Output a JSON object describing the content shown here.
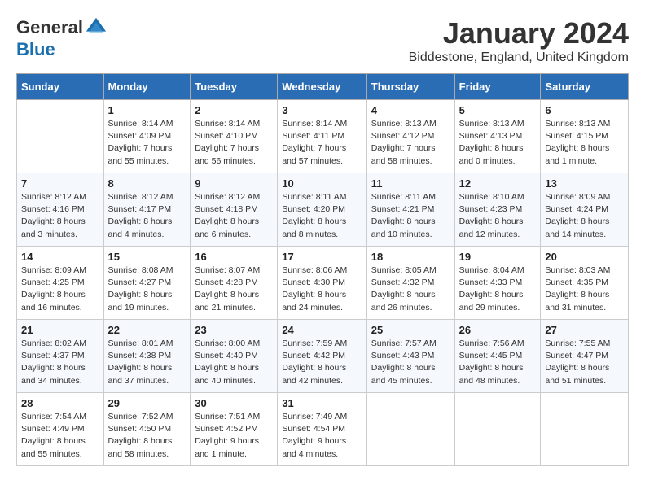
{
  "logo": {
    "general": "General",
    "blue": "Blue"
  },
  "title": "January 2024",
  "location": "Biddestone, England, United Kingdom",
  "days_header": [
    "Sunday",
    "Monday",
    "Tuesday",
    "Wednesday",
    "Thursday",
    "Friday",
    "Saturday"
  ],
  "weeks": [
    [
      {
        "num": "",
        "sunrise": "",
        "sunset": "",
        "daylight": ""
      },
      {
        "num": "1",
        "sunrise": "Sunrise: 8:14 AM",
        "sunset": "Sunset: 4:09 PM",
        "daylight": "Daylight: 7 hours and 55 minutes."
      },
      {
        "num": "2",
        "sunrise": "Sunrise: 8:14 AM",
        "sunset": "Sunset: 4:10 PM",
        "daylight": "Daylight: 7 hours and 56 minutes."
      },
      {
        "num": "3",
        "sunrise": "Sunrise: 8:14 AM",
        "sunset": "Sunset: 4:11 PM",
        "daylight": "Daylight: 7 hours and 57 minutes."
      },
      {
        "num": "4",
        "sunrise": "Sunrise: 8:13 AM",
        "sunset": "Sunset: 4:12 PM",
        "daylight": "Daylight: 7 hours and 58 minutes."
      },
      {
        "num": "5",
        "sunrise": "Sunrise: 8:13 AM",
        "sunset": "Sunset: 4:13 PM",
        "daylight": "Daylight: 8 hours and 0 minutes."
      },
      {
        "num": "6",
        "sunrise": "Sunrise: 8:13 AM",
        "sunset": "Sunset: 4:15 PM",
        "daylight": "Daylight: 8 hours and 1 minute."
      }
    ],
    [
      {
        "num": "7",
        "sunrise": "Sunrise: 8:12 AM",
        "sunset": "Sunset: 4:16 PM",
        "daylight": "Daylight: 8 hours and 3 minutes."
      },
      {
        "num": "8",
        "sunrise": "Sunrise: 8:12 AM",
        "sunset": "Sunset: 4:17 PM",
        "daylight": "Daylight: 8 hours and 4 minutes."
      },
      {
        "num": "9",
        "sunrise": "Sunrise: 8:12 AM",
        "sunset": "Sunset: 4:18 PM",
        "daylight": "Daylight: 8 hours and 6 minutes."
      },
      {
        "num": "10",
        "sunrise": "Sunrise: 8:11 AM",
        "sunset": "Sunset: 4:20 PM",
        "daylight": "Daylight: 8 hours and 8 minutes."
      },
      {
        "num": "11",
        "sunrise": "Sunrise: 8:11 AM",
        "sunset": "Sunset: 4:21 PM",
        "daylight": "Daylight: 8 hours and 10 minutes."
      },
      {
        "num": "12",
        "sunrise": "Sunrise: 8:10 AM",
        "sunset": "Sunset: 4:23 PM",
        "daylight": "Daylight: 8 hours and 12 minutes."
      },
      {
        "num": "13",
        "sunrise": "Sunrise: 8:09 AM",
        "sunset": "Sunset: 4:24 PM",
        "daylight": "Daylight: 8 hours and 14 minutes."
      }
    ],
    [
      {
        "num": "14",
        "sunrise": "Sunrise: 8:09 AM",
        "sunset": "Sunset: 4:25 PM",
        "daylight": "Daylight: 8 hours and 16 minutes."
      },
      {
        "num": "15",
        "sunrise": "Sunrise: 8:08 AM",
        "sunset": "Sunset: 4:27 PM",
        "daylight": "Daylight: 8 hours and 19 minutes."
      },
      {
        "num": "16",
        "sunrise": "Sunrise: 8:07 AM",
        "sunset": "Sunset: 4:28 PM",
        "daylight": "Daylight: 8 hours and 21 minutes."
      },
      {
        "num": "17",
        "sunrise": "Sunrise: 8:06 AM",
        "sunset": "Sunset: 4:30 PM",
        "daylight": "Daylight: 8 hours and 24 minutes."
      },
      {
        "num": "18",
        "sunrise": "Sunrise: 8:05 AM",
        "sunset": "Sunset: 4:32 PM",
        "daylight": "Daylight: 8 hours and 26 minutes."
      },
      {
        "num": "19",
        "sunrise": "Sunrise: 8:04 AM",
        "sunset": "Sunset: 4:33 PM",
        "daylight": "Daylight: 8 hours and 29 minutes."
      },
      {
        "num": "20",
        "sunrise": "Sunrise: 8:03 AM",
        "sunset": "Sunset: 4:35 PM",
        "daylight": "Daylight: 8 hours and 31 minutes."
      }
    ],
    [
      {
        "num": "21",
        "sunrise": "Sunrise: 8:02 AM",
        "sunset": "Sunset: 4:37 PM",
        "daylight": "Daylight: 8 hours and 34 minutes."
      },
      {
        "num": "22",
        "sunrise": "Sunrise: 8:01 AM",
        "sunset": "Sunset: 4:38 PM",
        "daylight": "Daylight: 8 hours and 37 minutes."
      },
      {
        "num": "23",
        "sunrise": "Sunrise: 8:00 AM",
        "sunset": "Sunset: 4:40 PM",
        "daylight": "Daylight: 8 hours and 40 minutes."
      },
      {
        "num": "24",
        "sunrise": "Sunrise: 7:59 AM",
        "sunset": "Sunset: 4:42 PM",
        "daylight": "Daylight: 8 hours and 42 minutes."
      },
      {
        "num": "25",
        "sunrise": "Sunrise: 7:57 AM",
        "sunset": "Sunset: 4:43 PM",
        "daylight": "Daylight: 8 hours and 45 minutes."
      },
      {
        "num": "26",
        "sunrise": "Sunrise: 7:56 AM",
        "sunset": "Sunset: 4:45 PM",
        "daylight": "Daylight: 8 hours and 48 minutes."
      },
      {
        "num": "27",
        "sunrise": "Sunrise: 7:55 AM",
        "sunset": "Sunset: 4:47 PM",
        "daylight": "Daylight: 8 hours and 51 minutes."
      }
    ],
    [
      {
        "num": "28",
        "sunrise": "Sunrise: 7:54 AM",
        "sunset": "Sunset: 4:49 PM",
        "daylight": "Daylight: 8 hours and 55 minutes."
      },
      {
        "num": "29",
        "sunrise": "Sunrise: 7:52 AM",
        "sunset": "Sunset: 4:50 PM",
        "daylight": "Daylight: 8 hours and 58 minutes."
      },
      {
        "num": "30",
        "sunrise": "Sunrise: 7:51 AM",
        "sunset": "Sunset: 4:52 PM",
        "daylight": "Daylight: 9 hours and 1 minute."
      },
      {
        "num": "31",
        "sunrise": "Sunrise: 7:49 AM",
        "sunset": "Sunset: 4:54 PM",
        "daylight": "Daylight: 9 hours and 4 minutes."
      },
      {
        "num": "",
        "sunrise": "",
        "sunset": "",
        "daylight": ""
      },
      {
        "num": "",
        "sunrise": "",
        "sunset": "",
        "daylight": ""
      },
      {
        "num": "",
        "sunrise": "",
        "sunset": "",
        "daylight": ""
      }
    ]
  ]
}
